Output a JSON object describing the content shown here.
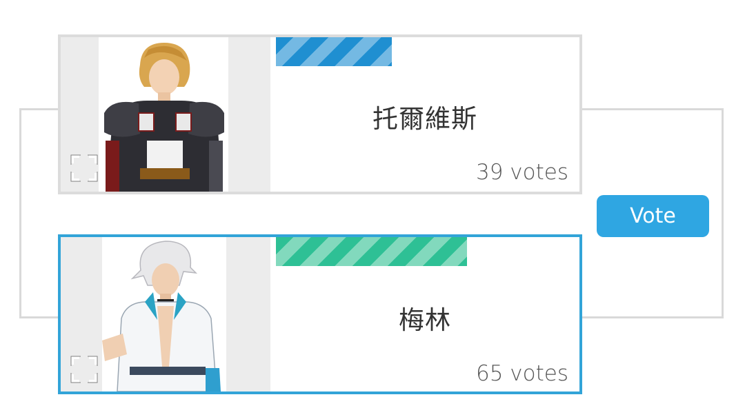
{
  "candidates": [
    {
      "name": "托爾維斯",
      "votes_label": "39 votes",
      "votes": 39,
      "bar_color": "#1f8fd1",
      "portrait_icon": "armored-knight-portrait",
      "selected": false
    },
    {
      "name": "梅林",
      "votes_label": "65 votes",
      "votes": 65,
      "bar_color": "#2ec095",
      "portrait_icon": "white-haired-youth-portrait",
      "selected": true
    }
  ],
  "vote_button": {
    "label": "Vote",
    "color": "#2fa6e2"
  },
  "colors": {
    "selected_border": "#32a4d8",
    "bracket": "#d9d9d9"
  }
}
